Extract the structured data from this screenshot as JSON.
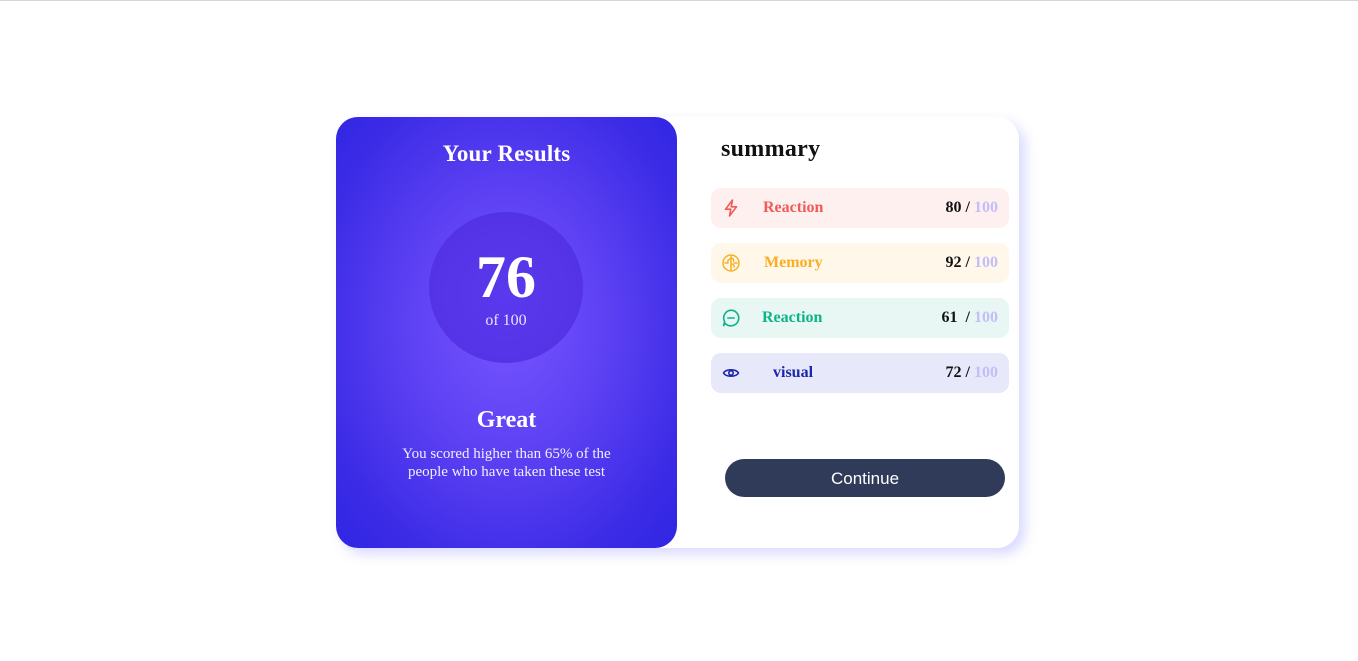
{
  "results": {
    "title": "Your Results",
    "score": "76",
    "score_of": "of 100",
    "grade": "Great",
    "description": "You scored higher than 65% of the people who have taken these test"
  },
  "summary": {
    "title": "summary",
    "items": [
      {
        "label": "Reaction",
        "score": "80",
        "separator": " / ",
        "max": "100",
        "icon": "lightning-icon",
        "color": "#f15a5a",
        "bg": "#fff0f0"
      },
      {
        "label": "Memory",
        "score": "92",
        "separator": " / ",
        "max": "100",
        "icon": "brain-icon",
        "color": "#f7b023",
        "bg": "#fff7ea"
      },
      {
        "label": "Reaction",
        "score": "61",
        "separator": "  / ",
        "max": "100",
        "icon": "chat-bubble-icon",
        "color": "#0bb48a",
        "bg": "#e8f7f3"
      },
      {
        "label": "visual",
        "score": "72",
        "separator": " / ",
        "max": "100",
        "icon": "eye-icon",
        "color": "#1b27a8",
        "bg": "#e7e8fa"
      }
    ],
    "continue_label": "Continue"
  },
  "colors": {
    "panel_gradient_center": "#7755ff",
    "panel_gradient_edge": "#2f26e3",
    "button_bg": "#303b59",
    "max_score": "#c4bdf8"
  }
}
